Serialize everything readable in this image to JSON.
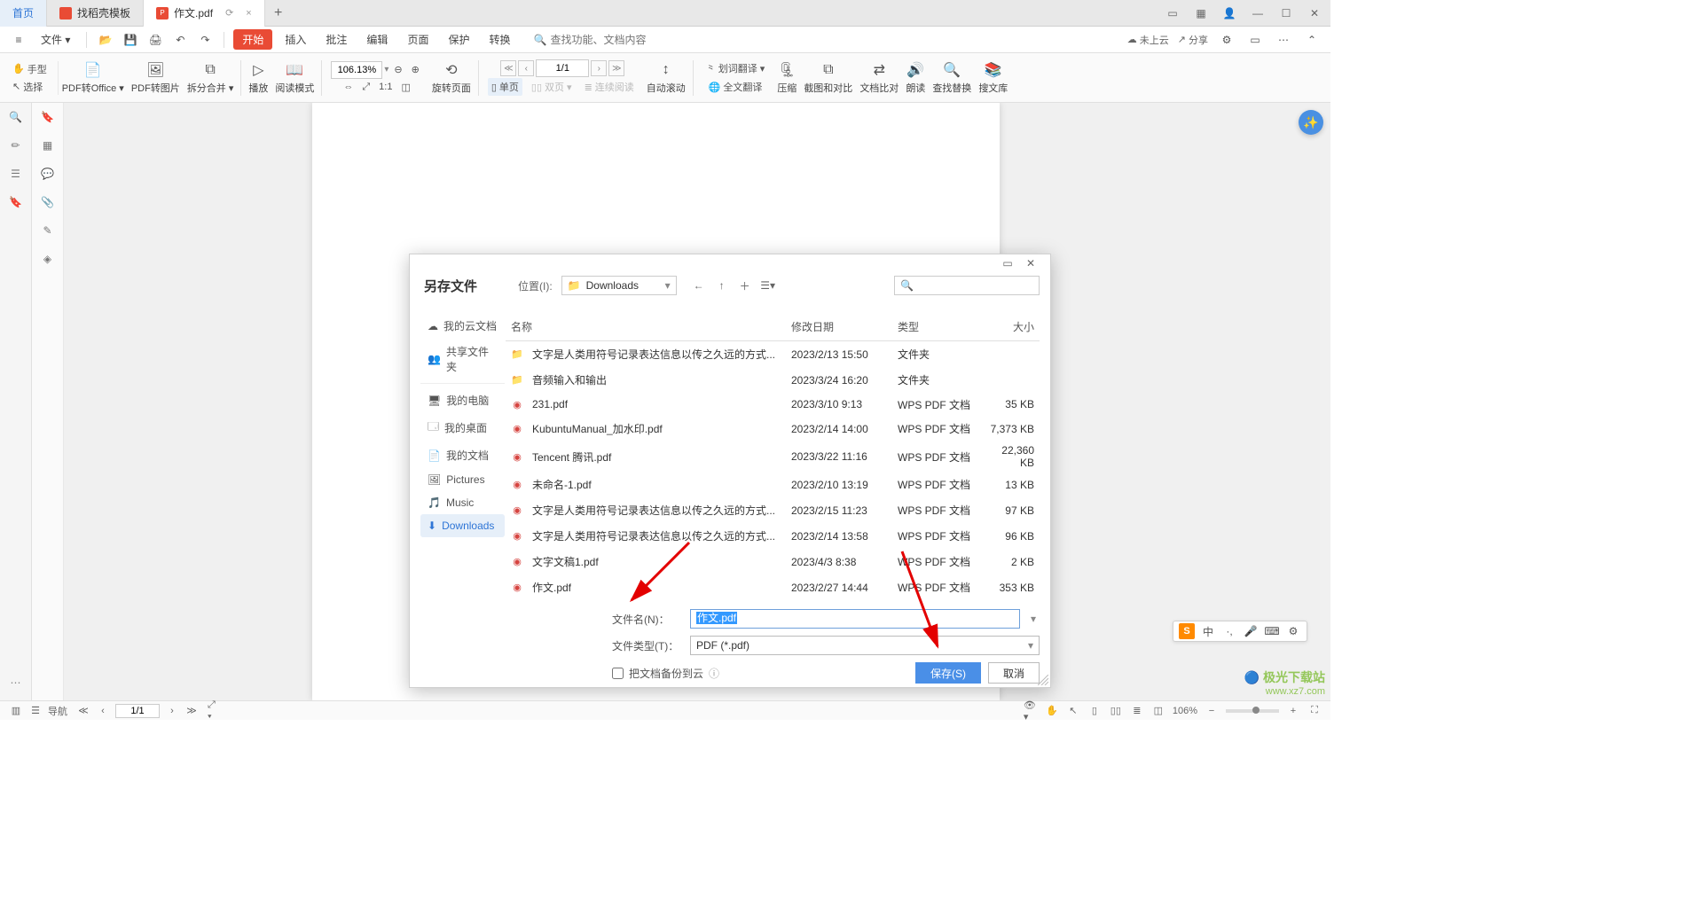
{
  "tabs": {
    "home": "首页",
    "t1": {
      "label": "找稻壳模板"
    },
    "t2": {
      "label": "作文.pdf"
    },
    "add": "+"
  },
  "menu": {
    "file": "文件",
    "start": "开始",
    "insert": "插入",
    "annotate": "批注",
    "edit": "编辑",
    "page": "页面",
    "protect": "保护",
    "convert": "转换",
    "search_placeholder": "查找功能、文档内容",
    "cloud": "未上云",
    "share": "分享"
  },
  "ribbon": {
    "hand": "手型",
    "select": "选择",
    "pdf2office": "PDF转Office",
    "pdf2img": "PDF转图片",
    "splitmerge": "拆分合并",
    "play": "播放",
    "readmode": "阅读模式",
    "zoom_value": "106.13%",
    "rotate": "旋转页面",
    "single": "单页",
    "double": "双页",
    "continuous": "连续阅读",
    "autoscroll": "自动滚动",
    "wordtrans": "划词翻译",
    "fulltrans": "全文翻译",
    "compress": "压缩",
    "screenshot": "截图和对比",
    "compare": "文档比对",
    "read": "朗读",
    "findreplace": "查找替换",
    "soupdf": "搜文库",
    "page_indicator": "1/1"
  },
  "dialog": {
    "title": "另存文件",
    "location_label": "位置(I):",
    "location_value": "Downloads",
    "search_placeholder": "",
    "sidebar": {
      "mycloud": "我的云文档",
      "shared": "共享文件夹",
      "computer": "我的电脑",
      "desktop": "我的桌面",
      "mydocs": "我的文档",
      "pictures": "Pictures",
      "music": "Music",
      "downloads": "Downloads"
    },
    "columns": {
      "name": "名称",
      "date": "修改日期",
      "type": "类型",
      "size": "大小"
    },
    "files": [
      {
        "icon": "folder",
        "name": "文字是人类用符号记录表达信息以传之久远的方式...",
        "date": "2023/2/13 15:50",
        "type": "文件夹",
        "size": ""
      },
      {
        "icon": "folder",
        "name": "音频输入和输出",
        "date": "2023/3/24 16:20",
        "type": "文件夹",
        "size": ""
      },
      {
        "icon": "pdf",
        "name": "231.pdf",
        "date": "2023/3/10 9:13",
        "type": "WPS PDF 文档",
        "size": "35 KB"
      },
      {
        "icon": "pdf",
        "name": "KubuntuManual_加水印.pdf",
        "date": "2023/2/14 14:00",
        "type": "WPS PDF 文档",
        "size": "7,373 KB"
      },
      {
        "icon": "pdf",
        "name": "Tencent 腾讯.pdf",
        "date": "2023/3/22 11:16",
        "type": "WPS PDF 文档",
        "size": "22,360 KB"
      },
      {
        "icon": "pdf",
        "name": "未命名-1.pdf",
        "date": "2023/2/10 13:19",
        "type": "WPS PDF 文档",
        "size": "13 KB"
      },
      {
        "icon": "pdf",
        "name": "文字是人类用符号记录表达信息以传之久远的方式...",
        "date": "2023/2/15 11:23",
        "type": "WPS PDF 文档",
        "size": "97 KB"
      },
      {
        "icon": "pdf",
        "name": "文字是人类用符号记录表达信息以传之久远的方式...",
        "date": "2023/2/14 13:58",
        "type": "WPS PDF 文档",
        "size": "96 KB"
      },
      {
        "icon": "pdf",
        "name": "文字文稿1.pdf",
        "date": "2023/4/3 8:38",
        "type": "WPS PDF 文档",
        "size": "2 KB"
      },
      {
        "icon": "pdf",
        "name": "作文.pdf",
        "date": "2023/2/27 14:44",
        "type": "WPS PDF 文档",
        "size": "353 KB"
      }
    ],
    "filename_label": "文件名(N)：",
    "filename_value": "作文.pdf",
    "filetype_label": "文件类型(T)：",
    "filetype_value": "PDF (*.pdf)",
    "backup_label": "把文档备份到云",
    "save_btn": "保存(S)",
    "cancel_btn": "取消"
  },
  "status": {
    "nav": "导航",
    "page": "1/1",
    "zoom": "106%"
  },
  "watermark": {
    "site": "极光下载站",
    "url": "www.xz7.com"
  },
  "ime": {
    "lang": "中"
  }
}
